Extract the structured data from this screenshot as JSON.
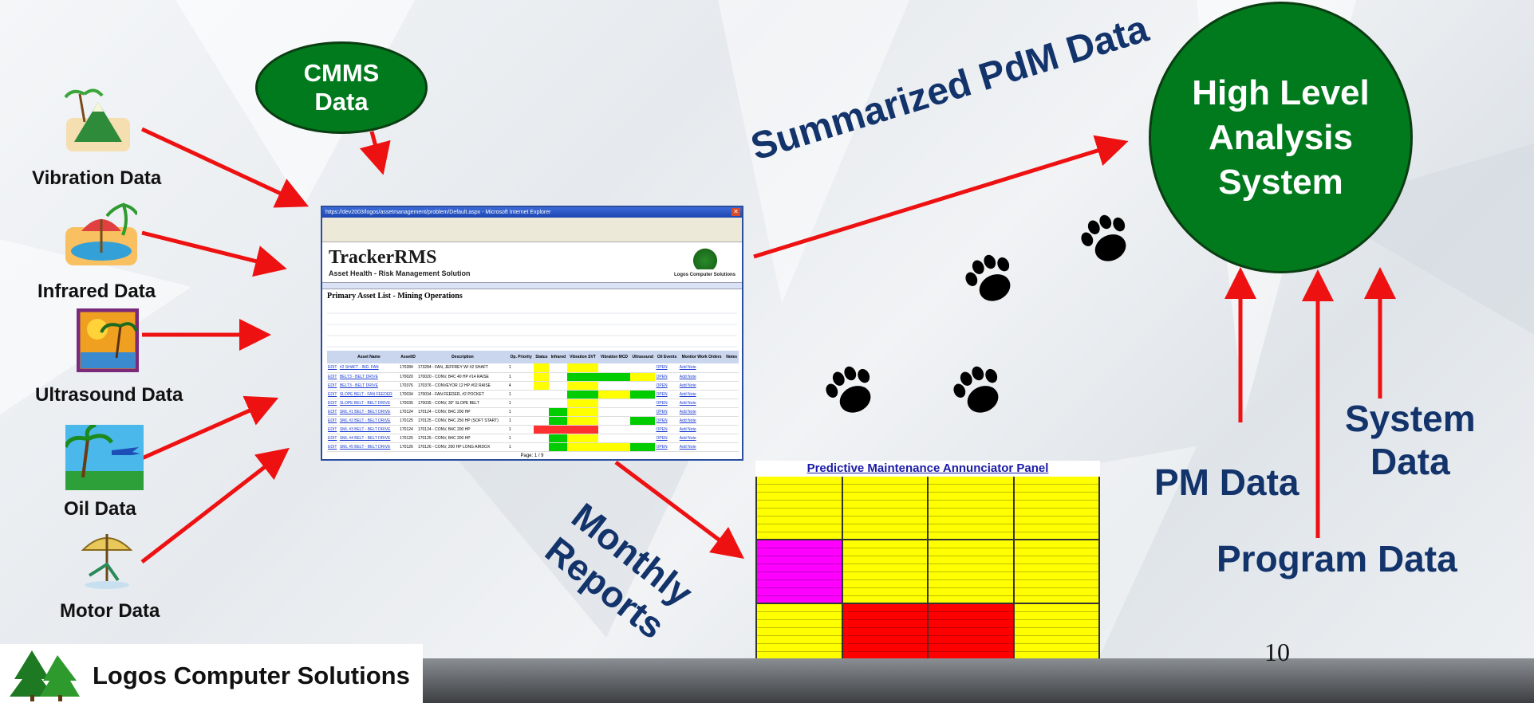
{
  "sources": [
    {
      "label": "Vibration Data",
      "icon": "island-mountain-icon"
    },
    {
      "label": "Infrared Data",
      "icon": "beach-umbrella-icon"
    },
    {
      "label": "Ultrasound Data",
      "icon": "sunset-palm-icon"
    },
    {
      "label": "Oil Data",
      "icon": "palm-airplane-icon"
    },
    {
      "label": "Motor Data",
      "icon": "beach-chair-icon"
    }
  ],
  "cmms": {
    "line1": "CMMS",
    "line2": "Data"
  },
  "hlas": {
    "line1": "High Level",
    "line2": "Analysis",
    "line3": "System"
  },
  "flow_labels": {
    "summarized": "Summarized PdM Data",
    "monthly_line1": "Monthly",
    "monthly_line2": "Reports",
    "pm": "PM Data",
    "program": "Program Data",
    "system_line1": "System",
    "system_line2": "Data"
  },
  "tracker": {
    "window_title": "https://dev2003/logos/assetmanagement/problem/Default.aspx - Microsoft Internet Explorer",
    "brand": "TrackerRMS",
    "subtitle": "Asset Health - Risk Management Solution",
    "company": "Logos Computer Solutions",
    "heading": "Primary Asset List - Mining Operations",
    "columns": [
      "",
      "Asset Name",
      "AssetID",
      "Description",
      "Op. Priority",
      "Status",
      "Infrared",
      "Vibration SVT",
      "Vibration MCD",
      "Ultrasound",
      "Oil Events",
      "Monitor Work Orders",
      "Notes"
    ],
    "rows": [
      [
        "EDIT",
        "#2 SHAFT - IND. FAN",
        "170284",
        "173284 - FAN, JEFFREY W/ #2 SHAFT",
        "1"
      ],
      [
        "EDIT",
        "BELT3 - BELT DRIVE",
        "170020",
        "170020 - CONV, B4C 40 HP #14 RAISE",
        "1"
      ],
      [
        "EDIT",
        "BELT3 - BELT DRIVE",
        "170376",
        "170376 - CONVEYOR 12 HP #02 RAISE",
        "4"
      ],
      [
        "EDIT",
        "SLOPE BELT - FAN FEEDER",
        "170034",
        "170034 - FAN FEEDER, #2 POCKET",
        "1"
      ],
      [
        "EDIT",
        "SLOPE BELT - BELT DRIVE",
        "170035",
        "170035 - CONV, 30\" SLOPE BELT",
        "1"
      ],
      [
        "EDIT",
        "SML #1 BELT - BELT DRIVE",
        "170124",
        "170124 - CONV, B4C 200 HP",
        "1"
      ],
      [
        "EDIT",
        "SML #2 BELT - BELT DRIVE",
        "170125",
        "170125 - CONV, B4C 250 HP (SOFT START)",
        "1"
      ],
      [
        "EDIT",
        "SML #3 BELT - BELT DRIVE",
        "170124",
        "170124 - CONV, B4C 200 HP",
        "1"
      ],
      [
        "EDIT",
        "SML #4 BELT - BELT DRIVE",
        "170125",
        "170125 - CONV, B4C 200 HP",
        "1"
      ],
      [
        "EDIT",
        "SML #5 BELT - BELT DRIVE",
        "170126",
        "170126 - CONV, 200 HP LONG AIRDOX",
        "1"
      ]
    ],
    "row_action": "OPEN",
    "row_note": "Add Note",
    "pager": "Page: 1 / 9"
  },
  "annunciator": {
    "title": "Predictive Maintenance Annunciator Panel"
  },
  "page_number": "10",
  "footer_company": "Logos Computer Solutions",
  "colors": {
    "green": "#007a1c",
    "arrow": "#ee1111",
    "navy": "#13336b",
    "yellow": "#ffff00",
    "magenta": "#ff00ff",
    "red": "#ff0000"
  }
}
